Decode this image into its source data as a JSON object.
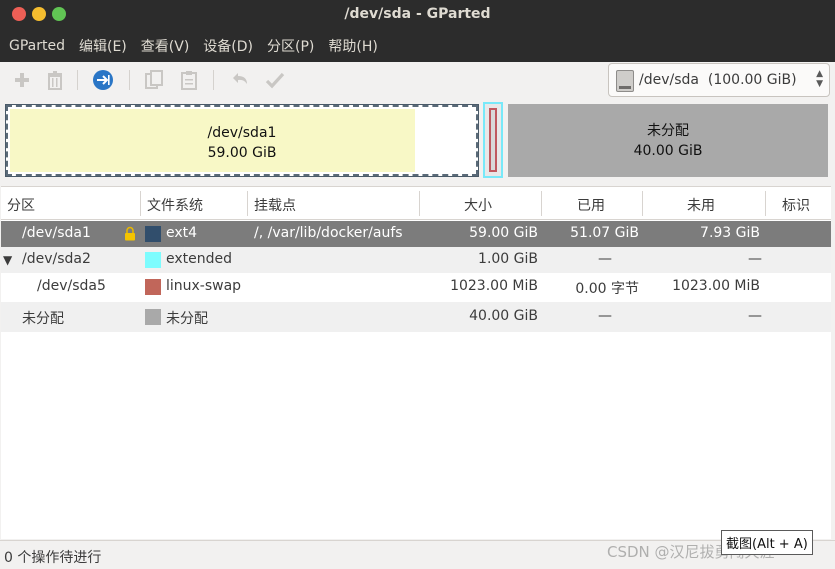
{
  "window": {
    "title": "/dev/sda - GParted"
  },
  "menu": [
    "GParted",
    "编辑(E)",
    "查看(V)",
    "设备(D)",
    "分区(P)",
    "帮助(H)"
  ],
  "toolbar": {
    "buttons": [
      "new-icon",
      "delete-icon",
      "resize-move-icon",
      "copy-icon",
      "paste-icon",
      "undo-icon",
      "apply-icon"
    ],
    "device_label": "/dev/sda  (100.00 GiB)"
  },
  "diskmap": {
    "sda1_name": "/dev/sda1",
    "sda1_size": "59.00 GiB",
    "sda1_used_fraction": 0.865,
    "unalloc_name": "未分配",
    "unalloc_size": "40.00 GiB"
  },
  "table": {
    "headers": [
      "分区",
      "文件系统",
      "挂载点",
      "大小",
      "已用",
      "未用",
      "标识"
    ],
    "rows": [
      {
        "partition": "/dev/sda1",
        "fs": "ext4",
        "mount": "/, /var/lib/docker/aufs",
        "size": "59.00 GiB",
        "used": "51.07 GiB",
        "unused": "7.93 GiB",
        "flags": "",
        "color": "#314e6c",
        "locked": true
      },
      {
        "partition": "/dev/sda2",
        "fs": "extended",
        "mount": "",
        "size": "1.00 GiB",
        "used": "—",
        "unused": "—",
        "flags": "",
        "color": "#7dfcfe",
        "expander": "▼"
      },
      {
        "partition": "/dev/sda5",
        "fs": "linux-swap",
        "mount": "",
        "size": "1023.00 MiB",
        "used": "0.00 字节",
        "unused": "1023.00 MiB",
        "flags": "",
        "color": "#c1665a"
      },
      {
        "partition": "未分配",
        "fs": "未分配",
        "mount": "",
        "size": "40.00 GiB",
        "used": "—",
        "unused": "—",
        "flags": "",
        "color": "#a9a9a9"
      }
    ]
  },
  "status": {
    "text": "0 个操作待进行"
  },
  "overlay": {
    "screenshot_tip": "截图(Alt + A)",
    "watermark": "CSDN @汉尼拔勇闯天涯"
  }
}
